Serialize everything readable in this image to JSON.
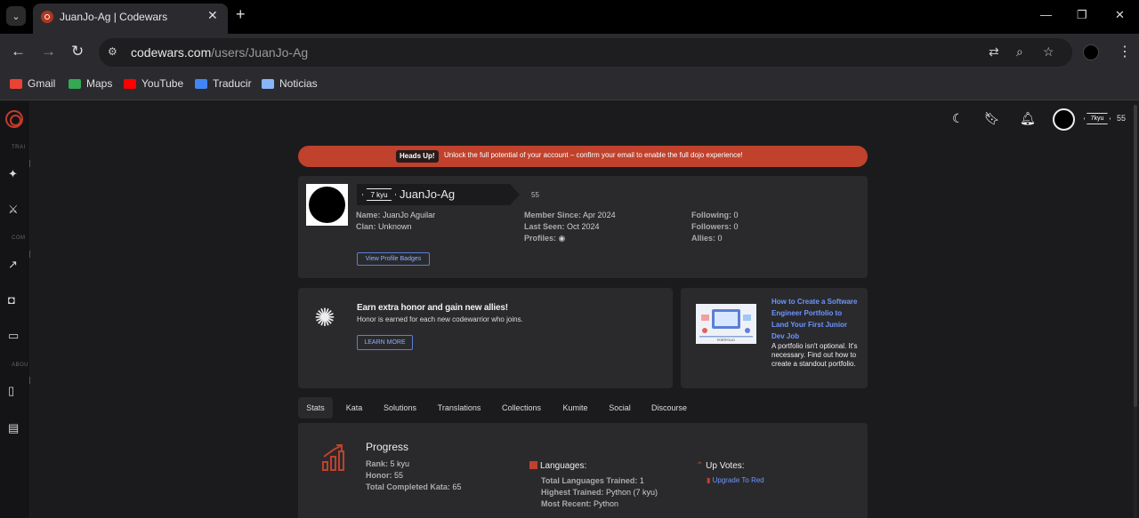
{
  "browser": {
    "tab_title": "JuanJo-Ag | Codewars",
    "url_host": "codewars.com",
    "url_path": "/users/JuanJo-Ag",
    "bookmarks": [
      {
        "label": "Gmail",
        "color": "#ea4335"
      },
      {
        "label": "Maps",
        "color": "#34a853"
      },
      {
        "label": "YouTube",
        "color": "#ff0000"
      },
      {
        "label": "Traducir",
        "color": "#4285f4"
      },
      {
        "label": "Noticias",
        "color": "#8ab4f8"
      }
    ]
  },
  "sidebar": {
    "sections": [
      "TRAI",
      "COM",
      "ABOU"
    ]
  },
  "header": {
    "rank": "7kyu",
    "honor": "55"
  },
  "alert": {
    "tag": "Heads Up!",
    "text": "Unlock the full potential of your account – confirm your email to enable the full dojo experience!"
  },
  "profile": {
    "rank": "7 kyu",
    "username": "JuanJo-Ag",
    "honor": "55",
    "name_label": "Name:",
    "name": "JuanJo Aguilar",
    "clan_label": "Clan:",
    "clan": "Unknown",
    "member_since_label": "Member Since:",
    "member_since": "Apr 2024",
    "last_seen_label": "Last Seen:",
    "last_seen": "Oct 2024",
    "profiles_label": "Profiles:",
    "following_label": "Following:",
    "following": "0",
    "followers_label": "Followers:",
    "followers": "0",
    "allies_label": "Allies:",
    "allies": "0",
    "badges_button": "View Profile Badges"
  },
  "allies_card": {
    "title": "Earn extra honor and gain new allies!",
    "subtitle": "Honor is earned for each new codewarrior who joins.",
    "button": "LEARN MORE"
  },
  "ad": {
    "title": "How to Create a Software Engineer Portfolio to Land Your First Junior Dev Job",
    "text": "A portfolio isn't optional. It's necessary. Find out how to create a standout portfolio.",
    "image_caption": "PORTFOLIO"
  },
  "tabs": [
    "Stats",
    "Kata",
    "Solutions",
    "Translations",
    "Collections",
    "Kumite",
    "Social",
    "Discourse"
  ],
  "stats": {
    "title": "Progress",
    "rank_label": "Rank:",
    "rank": "5 kyu",
    "honor_label": "Honor:",
    "honor": "55",
    "kata_label": "Total Completed Kata:",
    "kata": "65",
    "languages_title": "Languages:",
    "total_lang_label": "Total Languages Trained:",
    "total_lang": "1",
    "highest_label": "Highest Trained:",
    "highest": "Python (7 kyu)",
    "recent_label": "Most Recent:",
    "recent": "Python",
    "upvotes_title": "Up Votes:",
    "upgrade_link": "Upgrade To Red"
  },
  "colors": {
    "accent": "#c0412c",
    "link": "#6d95ff"
  }
}
